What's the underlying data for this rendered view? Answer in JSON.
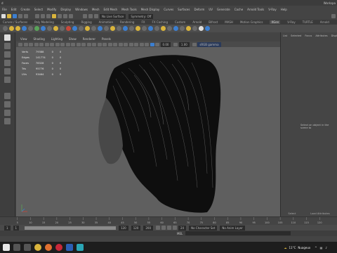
{
  "window": {
    "title_glyph": "d",
    "top_right": "Workspa"
  },
  "menubar": [
    "File",
    "Edit",
    "Create",
    "Select",
    "Modify",
    "Display",
    "Windows",
    "Mesh",
    "Edit Mesh",
    "Mesh Tools",
    "Mesh Display",
    "Curves",
    "Surfaces",
    "Deform",
    "UV",
    "Generate",
    "Cache",
    "Arnold Tools",
    "V-Ray",
    "Help"
  ],
  "status_line": {
    "live_surface": "No Live Surface",
    "symmetry": "Symmetry: Off"
  },
  "shelf_tabs": [
    "Curves / Surfaces",
    "Poly Modeling",
    "Sculpting",
    "Rigging",
    "Animation",
    "Rendering",
    "FX",
    "FX Caching",
    "Custom",
    "Arnold",
    "Bifrost",
    "MASH",
    "Motion Graphics",
    "XGen",
    "V-Ray",
    "TURTLE",
    "Arnold"
  ],
  "shelf_active": "XGen",
  "viewport_menu": [
    "View",
    "Shading",
    "Lighting",
    "Show",
    "Renderer",
    "Panels"
  ],
  "viewport_fields": {
    "value_a": "0.00",
    "value_b": "1.00",
    "colorspace": "sRGB gamma"
  },
  "hud_stats": [
    {
      "label": "Verts",
      "value": "79388",
      "c1": "0",
      "c2": "0"
    },
    {
      "label": "Edges",
      "value": "141774",
      "c1": "0",
      "c2": "0"
    },
    {
      "label": "Faces",
      "value": "78328",
      "c1": "0",
      "c2": "0"
    },
    {
      "label": "Tris",
      "value": "95776",
      "c1": "0",
      "c2": "0"
    },
    {
      "label": "UVs",
      "value": "93464",
      "c1": "0",
      "c2": "0"
    }
  ],
  "right_panel": {
    "tabs": [
      "List",
      "Selected",
      "Focus",
      "Attributes",
      "Display"
    ],
    "message": "Select an object in the scene to",
    "buttons": [
      "Select",
      "Load Attributes"
    ]
  },
  "timeslider_ticks": [
    "5",
    "10",
    "15",
    "20",
    "25",
    "30",
    "35",
    "40",
    "45",
    "50",
    "55",
    "60",
    "65",
    "70",
    "75",
    "80",
    "85",
    "90",
    "95",
    "100",
    "105",
    "110",
    "115",
    "120"
  ],
  "range": {
    "start": "1",
    "current": "1",
    "range_start": "120",
    "range_end": "120",
    "end": "200",
    "fps": "24",
    "charset": "No Character Set",
    "anim_layer": "No Anim Layer"
  },
  "command_line": {
    "lang": "MEL"
  },
  "taskbar": {
    "weather_temp": "11°C",
    "weather_text": "Nuageux"
  },
  "colors": {
    "viewport_bg": "#5f5f5f",
    "accent_yellow": "#d9b43c",
    "accent_blue": "#3c7fd0"
  }
}
